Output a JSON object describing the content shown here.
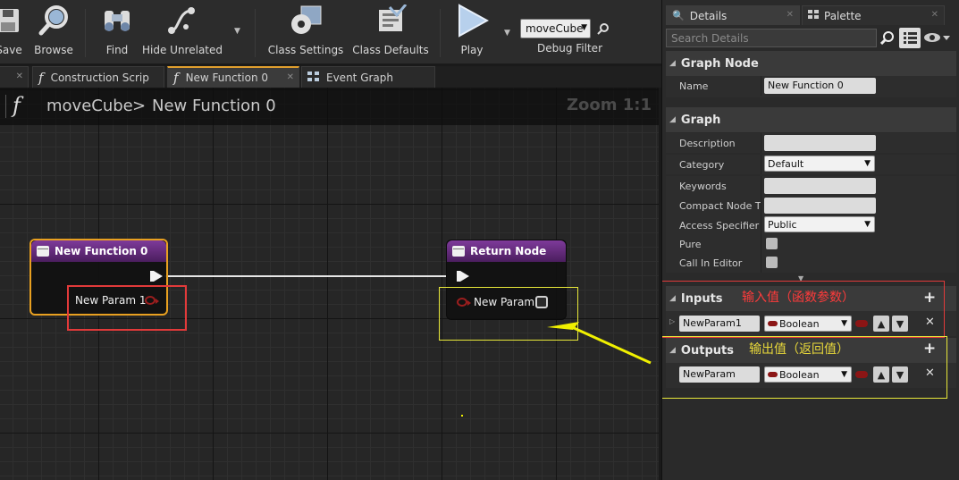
{
  "colors": {
    "accent_tab": "#e09f2e",
    "annotation_red": "#e23a3a",
    "annotation_yellow": "#e8e83a",
    "bool_pin": "#9c1e1e",
    "node_header": "#7e3a9a"
  },
  "toolbar": {
    "save_label": "Save",
    "browse_label": "Browse",
    "find_label": "Find",
    "hide_unrelated_label": "Hide Unrelated",
    "class_settings_label": "Class Settings",
    "class_defaults_label": "Class Defaults",
    "play_label": "Play",
    "debug_object": "moveCube",
    "debug_filter_label": "Debug Filter"
  },
  "tabs": [
    {
      "label": "Construction Scrip",
      "icon": "function-icon"
    },
    {
      "label": "New Function 0",
      "icon": "function-icon"
    },
    {
      "label": "Event Graph",
      "icon": "graph-icon"
    }
  ],
  "graph": {
    "breadcrumb_root": "moveCube",
    "breadcrumb_sep": ">",
    "breadcrumb_current": "New Function 0",
    "zoom": "Zoom 1:1",
    "entry_node": {
      "title": "New Function 0",
      "pin_label": "New Param 1"
    },
    "return_node": {
      "title": "Return Node",
      "pin_label": "New Param"
    }
  },
  "details": {
    "tab_details": "Details",
    "tab_palette": "Palette",
    "search_placeholder": "Search Details",
    "graph_node_section": "Graph Node",
    "name_label": "Name",
    "name_value": "New Function 0",
    "graph_section": "Graph",
    "description_label": "Description",
    "description_value": "",
    "category_label": "Category",
    "category_value": "Default",
    "keywords_label": "Keywords",
    "keywords_value": "",
    "compact_title_label": "Compact Node Tit",
    "compact_title_value": "",
    "access_label": "Access Specifier",
    "access_value": "Public",
    "pure_label": "Pure",
    "call_in_editor_label": "Call In Editor",
    "inputs_section": "Inputs",
    "inputs_annotation": "输入值（函数参数）",
    "input_param_name": "NewParam1",
    "input_param_type": "Boolean",
    "outputs_section": "Outputs",
    "outputs_annotation": "输出值（返回值）",
    "output_param_name": "NewParam",
    "output_param_type": "Boolean"
  }
}
